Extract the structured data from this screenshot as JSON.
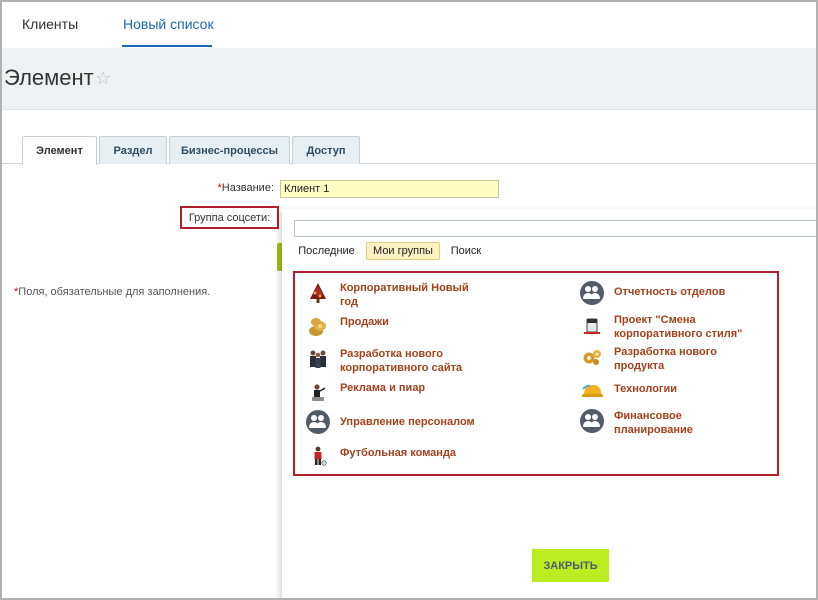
{
  "topnav": {
    "items": [
      {
        "label": "Клиенты",
        "active": false
      },
      {
        "label": "Новый список",
        "active": true
      }
    ],
    "accent_color": "#2067b0"
  },
  "page": {
    "title": "Элемент",
    "star_icon": "star-outline-icon"
  },
  "tabs": [
    {
      "label": "Элемент",
      "active": true
    },
    {
      "label": "Раздел",
      "active": false
    },
    {
      "label": "Бизнес-процессы",
      "active": false
    },
    {
      "label": "Доступ",
      "active": false
    }
  ],
  "form": {
    "name_label": "Название:",
    "name_required_mark": "*",
    "name_value": "Клиент 1",
    "group_label": "Группа соцсети:",
    "required_note_mark": "*",
    "required_note": "Поля, обязательные для заполнения."
  },
  "popup": {
    "search_value": "",
    "tabs": [
      {
        "label": "Последние",
        "active": false
      },
      {
        "label": "Мои группы",
        "active": true
      },
      {
        "label": "Поиск",
        "active": false
      }
    ],
    "groups": [
      {
        "label": "Корпоративный Новый год",
        "icon": "christmas-tree-icon"
      },
      {
        "label": "Отчетность отделов",
        "icon": "group-avatar-icon"
      },
      {
        "label": "Продажи",
        "icon": "coins-icon"
      },
      {
        "label": "Проект \"Смена корпоративного стиля\"",
        "icon": "paint-bucket-icon"
      },
      {
        "label": "Разработка нового корпоративного сайта",
        "icon": "team-icon"
      },
      {
        "label": "Разработка нового продукта",
        "icon": "gears-icon"
      },
      {
        "label": "Реклама и пиар",
        "icon": "presenter-icon"
      },
      {
        "label": "Технологии",
        "icon": "helmet-icon"
      },
      {
        "label": "Управление персоналом",
        "icon": "group-avatar-icon"
      },
      {
        "label": "Финансовое планирование",
        "icon": "group-avatar-icon"
      },
      {
        "label": "Футбольная команда",
        "icon": "football-player-icon"
      }
    ],
    "close_label": "ЗАКРЫТЬ",
    "close_color": "#bbed21",
    "highlight_color": "#b0202a"
  }
}
